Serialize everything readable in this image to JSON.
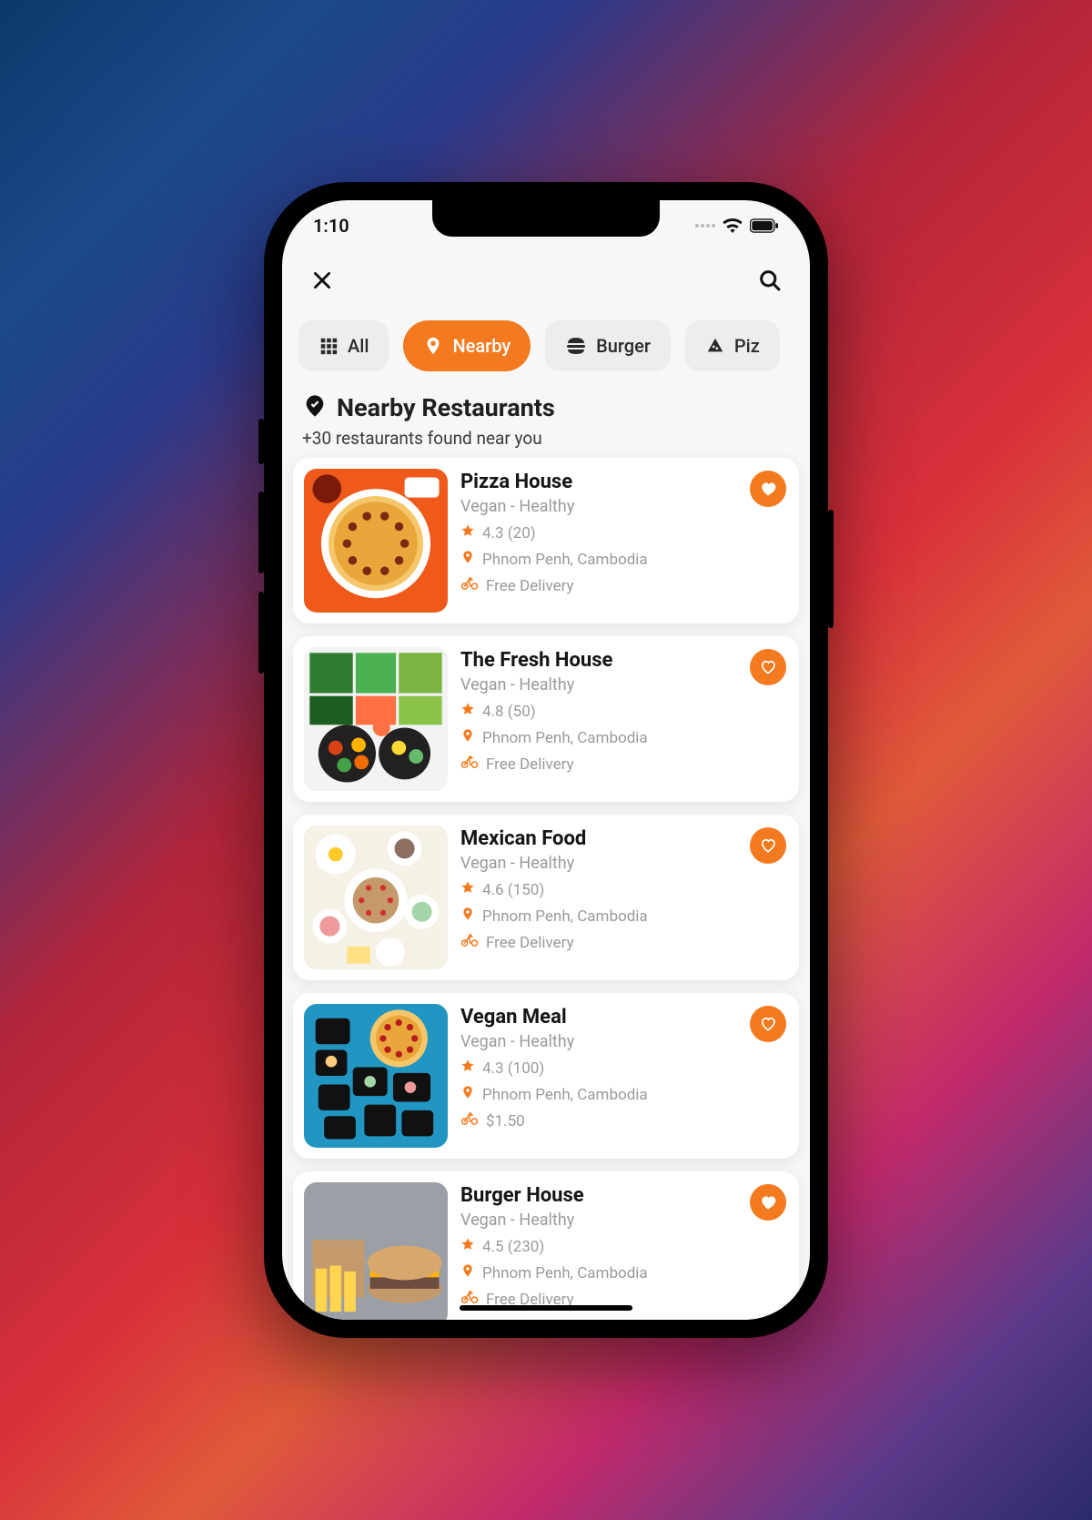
{
  "status": {
    "time": "1:10"
  },
  "chips": [
    {
      "icon": "grid",
      "label": "All",
      "active": false
    },
    {
      "icon": "pin",
      "label": "Nearby",
      "active": true
    },
    {
      "icon": "burger",
      "label": "Burger",
      "active": false
    },
    {
      "icon": "pizza",
      "label": "Piz",
      "active": false
    }
  ],
  "section": {
    "title": "Nearby Restaurants",
    "subtitle": "+30 restaurants found near you"
  },
  "restaurants": [
    {
      "name": "Pizza House",
      "tags": "Vegan - Healthy",
      "rating": "4.3",
      "reviews": "20",
      "location": "Phnom Penh, Cambodia",
      "delivery": "Free Delivery",
      "fav_filled": true,
      "thumb": "pizza"
    },
    {
      "name": "The Fresh House",
      "tags": "Vegan - Healthy",
      "rating": "4.8",
      "reviews": "50",
      "location": "Phnom Penh, Cambodia",
      "delivery": "Free Delivery",
      "fav_filled": false,
      "thumb": "salad"
    },
    {
      "name": "Mexican Food",
      "tags": "Vegan - Healthy",
      "rating": "4.6",
      "reviews": "150",
      "location": "Phnom Penh, Cambodia",
      "delivery": "Free Delivery",
      "fav_filled": false,
      "thumb": "brunch"
    },
    {
      "name": "Vegan Meal",
      "tags": "Vegan - Healthy",
      "rating": "4.3",
      "reviews": "100",
      "location": "Phnom Penh, Cambodia",
      "delivery": "$1.50",
      "fav_filled": false,
      "thumb": "boxes"
    },
    {
      "name": "Burger House",
      "tags": "Vegan - Healthy",
      "rating": "4.5",
      "reviews": "230",
      "location": "Phnom Penh, Cambodia",
      "delivery": "Free Delivery",
      "fav_filled": true,
      "thumb": "burger"
    }
  ]
}
